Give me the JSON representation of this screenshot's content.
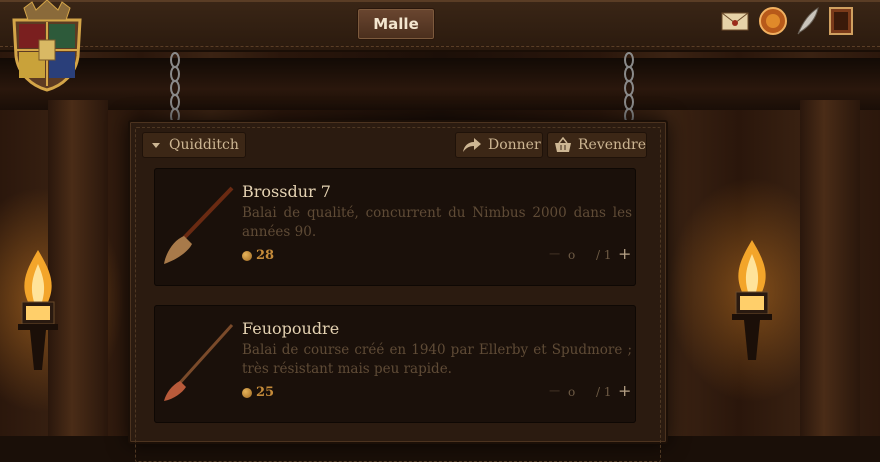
{
  "header": {
    "title": "Malle",
    "icons": [
      "letter-icon",
      "owl-icon",
      "quill-icon",
      "portrait-icon"
    ]
  },
  "toolbar": {
    "category_label": "Quidditch",
    "give_label": "Donner",
    "resell_label": "Revendre"
  },
  "items": [
    {
      "name": "Brossdur 7",
      "description": "Balai de qualité, concurrent du Nimbus 2000 dans les années 90.",
      "price": "28",
      "quantity": "o",
      "max": "/ 1"
    },
    {
      "name": "Feuopoudre",
      "description": "Balai de course créé en 1940 par Ellerby et Spudmore ; très résistant mais peu rapide.",
      "price": "25",
      "quantity": "o",
      "max": "/ 1"
    }
  ]
}
